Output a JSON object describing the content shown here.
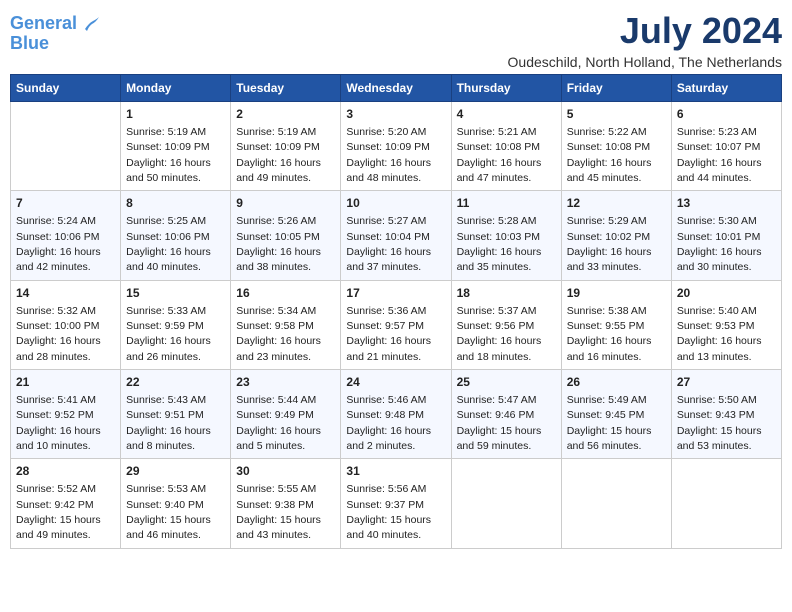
{
  "header": {
    "logo_line1": "General",
    "logo_line2": "Blue",
    "month": "July 2024",
    "location": "Oudeschild, North Holland, The Netherlands"
  },
  "days_of_week": [
    "Sunday",
    "Monday",
    "Tuesday",
    "Wednesday",
    "Thursday",
    "Friday",
    "Saturday"
  ],
  "weeks": [
    [
      {
        "day": "",
        "info": ""
      },
      {
        "day": "1",
        "info": "Sunrise: 5:19 AM\nSunset: 10:09 PM\nDaylight: 16 hours\nand 50 minutes."
      },
      {
        "day": "2",
        "info": "Sunrise: 5:19 AM\nSunset: 10:09 PM\nDaylight: 16 hours\nand 49 minutes."
      },
      {
        "day": "3",
        "info": "Sunrise: 5:20 AM\nSunset: 10:09 PM\nDaylight: 16 hours\nand 48 minutes."
      },
      {
        "day": "4",
        "info": "Sunrise: 5:21 AM\nSunset: 10:08 PM\nDaylight: 16 hours\nand 47 minutes."
      },
      {
        "day": "5",
        "info": "Sunrise: 5:22 AM\nSunset: 10:08 PM\nDaylight: 16 hours\nand 45 minutes."
      },
      {
        "day": "6",
        "info": "Sunrise: 5:23 AM\nSunset: 10:07 PM\nDaylight: 16 hours\nand 44 minutes."
      }
    ],
    [
      {
        "day": "7",
        "info": "Sunrise: 5:24 AM\nSunset: 10:06 PM\nDaylight: 16 hours\nand 42 minutes."
      },
      {
        "day": "8",
        "info": "Sunrise: 5:25 AM\nSunset: 10:06 PM\nDaylight: 16 hours\nand 40 minutes."
      },
      {
        "day": "9",
        "info": "Sunrise: 5:26 AM\nSunset: 10:05 PM\nDaylight: 16 hours\nand 38 minutes."
      },
      {
        "day": "10",
        "info": "Sunrise: 5:27 AM\nSunset: 10:04 PM\nDaylight: 16 hours\nand 37 minutes."
      },
      {
        "day": "11",
        "info": "Sunrise: 5:28 AM\nSunset: 10:03 PM\nDaylight: 16 hours\nand 35 minutes."
      },
      {
        "day": "12",
        "info": "Sunrise: 5:29 AM\nSunset: 10:02 PM\nDaylight: 16 hours\nand 33 minutes."
      },
      {
        "day": "13",
        "info": "Sunrise: 5:30 AM\nSunset: 10:01 PM\nDaylight: 16 hours\nand 30 minutes."
      }
    ],
    [
      {
        "day": "14",
        "info": "Sunrise: 5:32 AM\nSunset: 10:00 PM\nDaylight: 16 hours\nand 28 minutes."
      },
      {
        "day": "15",
        "info": "Sunrise: 5:33 AM\nSunset: 9:59 PM\nDaylight: 16 hours\nand 26 minutes."
      },
      {
        "day": "16",
        "info": "Sunrise: 5:34 AM\nSunset: 9:58 PM\nDaylight: 16 hours\nand 23 minutes."
      },
      {
        "day": "17",
        "info": "Sunrise: 5:36 AM\nSunset: 9:57 PM\nDaylight: 16 hours\nand 21 minutes."
      },
      {
        "day": "18",
        "info": "Sunrise: 5:37 AM\nSunset: 9:56 PM\nDaylight: 16 hours\nand 18 minutes."
      },
      {
        "day": "19",
        "info": "Sunrise: 5:38 AM\nSunset: 9:55 PM\nDaylight: 16 hours\nand 16 minutes."
      },
      {
        "day": "20",
        "info": "Sunrise: 5:40 AM\nSunset: 9:53 PM\nDaylight: 16 hours\nand 13 minutes."
      }
    ],
    [
      {
        "day": "21",
        "info": "Sunrise: 5:41 AM\nSunset: 9:52 PM\nDaylight: 16 hours\nand 10 minutes."
      },
      {
        "day": "22",
        "info": "Sunrise: 5:43 AM\nSunset: 9:51 PM\nDaylight: 16 hours\nand 8 minutes."
      },
      {
        "day": "23",
        "info": "Sunrise: 5:44 AM\nSunset: 9:49 PM\nDaylight: 16 hours\nand 5 minutes."
      },
      {
        "day": "24",
        "info": "Sunrise: 5:46 AM\nSunset: 9:48 PM\nDaylight: 16 hours\nand 2 minutes."
      },
      {
        "day": "25",
        "info": "Sunrise: 5:47 AM\nSunset: 9:46 PM\nDaylight: 15 hours\nand 59 minutes."
      },
      {
        "day": "26",
        "info": "Sunrise: 5:49 AM\nSunset: 9:45 PM\nDaylight: 15 hours\nand 56 minutes."
      },
      {
        "day": "27",
        "info": "Sunrise: 5:50 AM\nSunset: 9:43 PM\nDaylight: 15 hours\nand 53 minutes."
      }
    ],
    [
      {
        "day": "28",
        "info": "Sunrise: 5:52 AM\nSunset: 9:42 PM\nDaylight: 15 hours\nand 49 minutes."
      },
      {
        "day": "29",
        "info": "Sunrise: 5:53 AM\nSunset: 9:40 PM\nDaylight: 15 hours\nand 46 minutes."
      },
      {
        "day": "30",
        "info": "Sunrise: 5:55 AM\nSunset: 9:38 PM\nDaylight: 15 hours\nand 43 minutes."
      },
      {
        "day": "31",
        "info": "Sunrise: 5:56 AM\nSunset: 9:37 PM\nDaylight: 15 hours\nand 40 minutes."
      },
      {
        "day": "",
        "info": ""
      },
      {
        "day": "",
        "info": ""
      },
      {
        "day": "",
        "info": ""
      }
    ]
  ]
}
